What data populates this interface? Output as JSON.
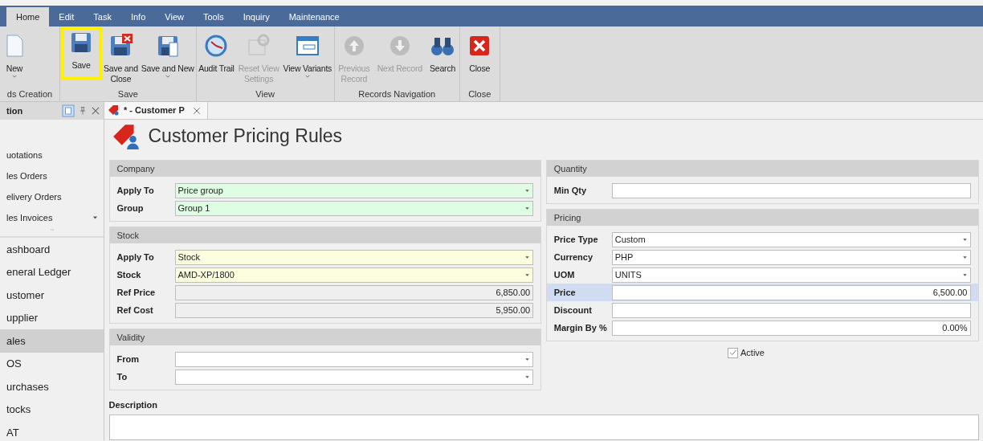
{
  "menu_tabs": [
    {
      "label": "Home",
      "selected": true
    },
    {
      "label": "Edit",
      "selected": false
    },
    {
      "label": "Task",
      "selected": false
    },
    {
      "label": "Info",
      "selected": false
    },
    {
      "label": "View",
      "selected": false
    },
    {
      "label": "Tools",
      "selected": false
    },
    {
      "label": "Inquiry",
      "selected": false
    },
    {
      "label": "Maintenance",
      "selected": false
    }
  ],
  "ribbon": {
    "groups": [
      {
        "label": "ds Creation",
        "buttons": [
          {
            "label": "New",
            "dropdown": true,
            "disabled": false,
            "highlighted": false
          }
        ]
      },
      {
        "label": "Save",
        "buttons": [
          {
            "label": "Save",
            "dropdown": false,
            "disabled": false,
            "highlighted": true
          },
          {
            "label": "Save and Close",
            "dropdown": false,
            "disabled": false,
            "highlighted": false
          },
          {
            "label": "Save and New",
            "dropdown": true,
            "disabled": false,
            "highlighted": false
          }
        ]
      },
      {
        "label": "View",
        "buttons": [
          {
            "label": "Audit Trail",
            "dropdown": false,
            "disabled": false,
            "highlighted": false
          },
          {
            "label": "Reset View Settings",
            "dropdown": false,
            "disabled": true,
            "highlighted": false
          },
          {
            "label": "View Variants",
            "dropdown": true,
            "disabled": false,
            "highlighted": false
          }
        ]
      },
      {
        "label": "Records Navigation",
        "buttons": [
          {
            "label": "Previous Record",
            "dropdown": false,
            "disabled": true,
            "highlighted": false
          },
          {
            "label": "Next Record",
            "dropdown": false,
            "disabled": true,
            "highlighted": false
          },
          {
            "label": "Search",
            "dropdown": false,
            "disabled": false,
            "highlighted": false
          }
        ]
      },
      {
        "label": "Close",
        "buttons": [
          {
            "label": "Close",
            "dropdown": false,
            "disabled": false,
            "highlighted": false
          }
        ]
      }
    ]
  },
  "navigation": {
    "title": "tion",
    "items": [
      {
        "label": "uotations",
        "kind": "sub",
        "selected": false,
        "dropdown": false
      },
      {
        "label": "les Orders",
        "kind": "sub",
        "selected": false,
        "dropdown": false
      },
      {
        "label": "elivery Orders",
        "kind": "sub",
        "selected": false,
        "dropdown": false
      },
      {
        "label": "les Invoices",
        "kind": "sub",
        "selected": false,
        "dropdown": true
      },
      {
        "label": "ashboard",
        "kind": "module",
        "selected": false
      },
      {
        "label": "eneral Ledger",
        "kind": "module",
        "selected": false
      },
      {
        "label": "ustomer",
        "kind": "module",
        "selected": false
      },
      {
        "label": "upplier",
        "kind": "module",
        "selected": false
      },
      {
        "label": "ales",
        "kind": "module",
        "selected": true
      },
      {
        "label": "OS",
        "kind": "module",
        "selected": false
      },
      {
        "label": "urchases",
        "kind": "module",
        "selected": false
      },
      {
        "label": "tocks",
        "kind": "module",
        "selected": false
      },
      {
        "label": "AT",
        "kind": "module",
        "selected": false
      }
    ]
  },
  "document_tab": {
    "label": "* - Customer P"
  },
  "form": {
    "title": "Customer Pricing Rules",
    "columns": [
      [
        {
          "title": "Company",
          "fields": [
            {
              "label": "Apply To",
              "kind": "combo",
              "value": "Price group",
              "color": "#dffde2",
              "focused": false
            },
            {
              "label": "Group",
              "kind": "combo",
              "value": "Group 1",
              "color": "#dffde2",
              "focused": false
            }
          ]
        },
        {
          "title": "Stock",
          "fields": [
            {
              "label": "Apply To",
              "kind": "combo",
              "value": "Stock",
              "color": "#fdfde0",
              "focused": false
            },
            {
              "label": "Stock",
              "kind": "combo",
              "value": "AMD-XP/1800",
              "color": "#fdfde0",
              "focused": false
            },
            {
              "label": "Ref Price",
              "kind": "readonly",
              "value": "6,850.00",
              "color": "#efefef",
              "focused": false
            },
            {
              "label": "Ref Cost",
              "kind": "readonly",
              "value": "5,950.00",
              "color": "#efefef",
              "focused": false
            }
          ]
        },
        {
          "title": "Validity",
          "fields": [
            {
              "label": "From",
              "kind": "combo",
              "color": "#ffffff",
              "focused": false
            },
            {
              "label": "To",
              "kind": "combo",
              "color": "#ffffff",
              "focused": false
            }
          ]
        }
      ],
      [
        {
          "title": "Quantity",
          "fields": [
            {
              "label": "Min Qty",
              "kind": "number",
              "color": "#ffffff",
              "focused": false
            }
          ]
        },
        {
          "title": "Pricing",
          "fields": [
            {
              "label": "Price Type",
              "kind": "combo",
              "value": "Custom",
              "color": "#ffffff",
              "focused": false
            },
            {
              "label": "Currency",
              "kind": "combo",
              "value": "PHP",
              "color": "#ffffff",
              "focused": false
            },
            {
              "label": "UOM",
              "kind": "combo",
              "value": "UNITS",
              "color": "#ffffff",
              "focused": false
            },
            {
              "label": "Price",
              "kind": "number",
              "value": "6,500.00",
              "color": "#ffffff",
              "focused": true
            },
            {
              "label": "Discount",
              "kind": "number",
              "color": "#ffffff",
              "focused": false
            },
            {
              "label": "Margin By %",
              "kind": "number",
              "value": "0.00%",
              "color": "#ffffff",
              "focused": false
            }
          ]
        }
      ]
    ],
    "active": {
      "label": "Active",
      "checked": true
    },
    "description": {
      "label": "Description"
    }
  }
}
